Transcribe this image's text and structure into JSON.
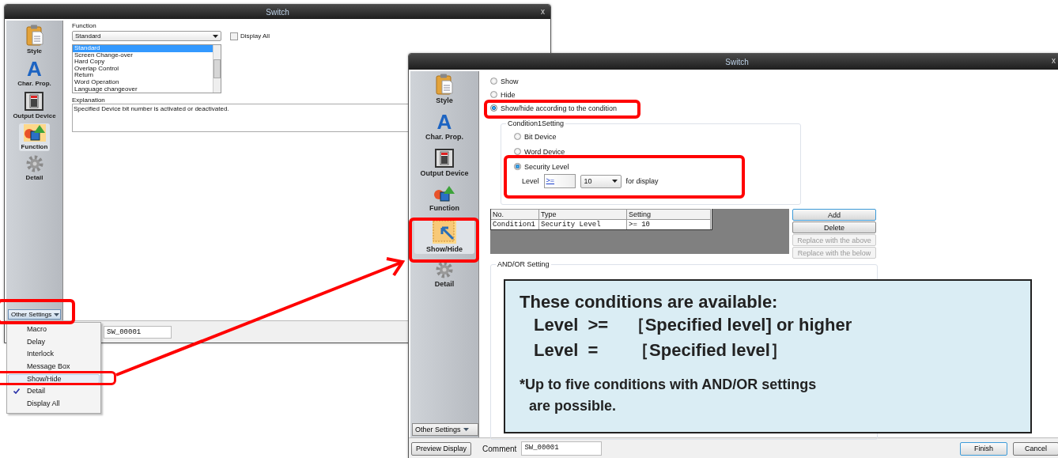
{
  "back_window": {
    "title": "Switch",
    "close": "x",
    "sidebar": [
      {
        "label": "Style",
        "kind": "clipboard",
        "selected": false
      },
      {
        "label": "Char. Prop.",
        "kind": "letter",
        "glyph": "A",
        "selected": false
      },
      {
        "label": "Output Device",
        "kind": "switch",
        "selected": false
      },
      {
        "label": "Function",
        "kind": "shapes",
        "selected": true
      },
      {
        "label": "Detail",
        "kind": "gear",
        "selected": false
      }
    ],
    "other_settings": "Other Settings",
    "function_label": "Function",
    "function_value": "Standard",
    "display_all": {
      "label": "Display All",
      "checked": false
    },
    "function_list": [
      {
        "label": "Standard",
        "selected": true
      },
      {
        "label": "Screen Change-over",
        "selected": false
      },
      {
        "label": "Hard Copy",
        "selected": false
      },
      {
        "label": "Overlap Control",
        "selected": false
      },
      {
        "label": "Return",
        "selected": false
      },
      {
        "label": "Word Operation",
        "selected": false
      },
      {
        "label": "Language changeover",
        "selected": false
      }
    ],
    "explanation_label": "Explanation",
    "explanation_text": "Specified Device bit number is activated or deactivated.",
    "comment_value": "SW_00001"
  },
  "menu": {
    "items": [
      {
        "label": "Macro",
        "checked": false,
        "selected": false
      },
      {
        "label": "Delay",
        "checked": false,
        "selected": false
      },
      {
        "label": "Interlock",
        "checked": false,
        "selected": false
      },
      {
        "label": "Message Box",
        "checked": false,
        "selected": false
      },
      {
        "label": "Show/Hide",
        "checked": false,
        "selected": true
      },
      {
        "label": "Detail",
        "checked": true,
        "selected": false
      },
      {
        "label": "Display All",
        "checked": false,
        "selected": false
      }
    ]
  },
  "front_window": {
    "title": "Switch",
    "close": "x",
    "sidebar": [
      {
        "label": "Style",
        "kind": "clipboard",
        "selected": false
      },
      {
        "label": "Char. Prop.",
        "kind": "letter",
        "glyph": "A",
        "selected": false
      },
      {
        "label": "Output Device",
        "kind": "switch",
        "selected": false
      },
      {
        "label": "Function",
        "kind": "shapes",
        "selected": false
      },
      {
        "label": "Show/Hide",
        "kind": "showhide",
        "selected": true
      },
      {
        "label": "Detail",
        "kind": "gear",
        "selected": false
      }
    ],
    "other_settings": "Other Settings",
    "visibility": [
      {
        "label": "Show",
        "selected": false
      },
      {
        "label": "Hide",
        "selected": false
      },
      {
        "label": "Show/hide according to the condition",
        "selected": true
      }
    ],
    "condition": {
      "title": "Condition1Setting",
      "options": [
        {
          "label": "Bit Device",
          "selected": false
        },
        {
          "label": "Word Device",
          "selected": false
        },
        {
          "label": "Security Level",
          "selected": true
        }
      ],
      "level_label": "Level",
      "operator": ">=",
      "level_value": "10",
      "suffix": "for display"
    },
    "table": {
      "columns": [
        "No.",
        "Type",
        "Setting"
      ],
      "rows": [
        [
          "Condition1",
          "Security Level",
          ">= 10"
        ]
      ]
    },
    "buttons": [
      {
        "label": "Add",
        "disabled": false
      },
      {
        "label": "Delete",
        "disabled": false
      },
      {
        "label": "Replace with the above",
        "disabled": true
      },
      {
        "label": "Replace with the below",
        "disabled": true
      }
    ],
    "andor_title": "AND/OR Setting",
    "footer": {
      "preview": "Preview Display",
      "comment_label": "Comment",
      "comment_value": "SW_00001",
      "finish": "Finish",
      "cancel": "Cancel"
    }
  },
  "callout": {
    "heading": "These conditions are available:",
    "lines": [
      "Level  >=    ［Specified level] or higher",
      "Level  =       ［Specified level］"
    ],
    "note": "*Up to five conditions with AND/OR settings are possible."
  }
}
